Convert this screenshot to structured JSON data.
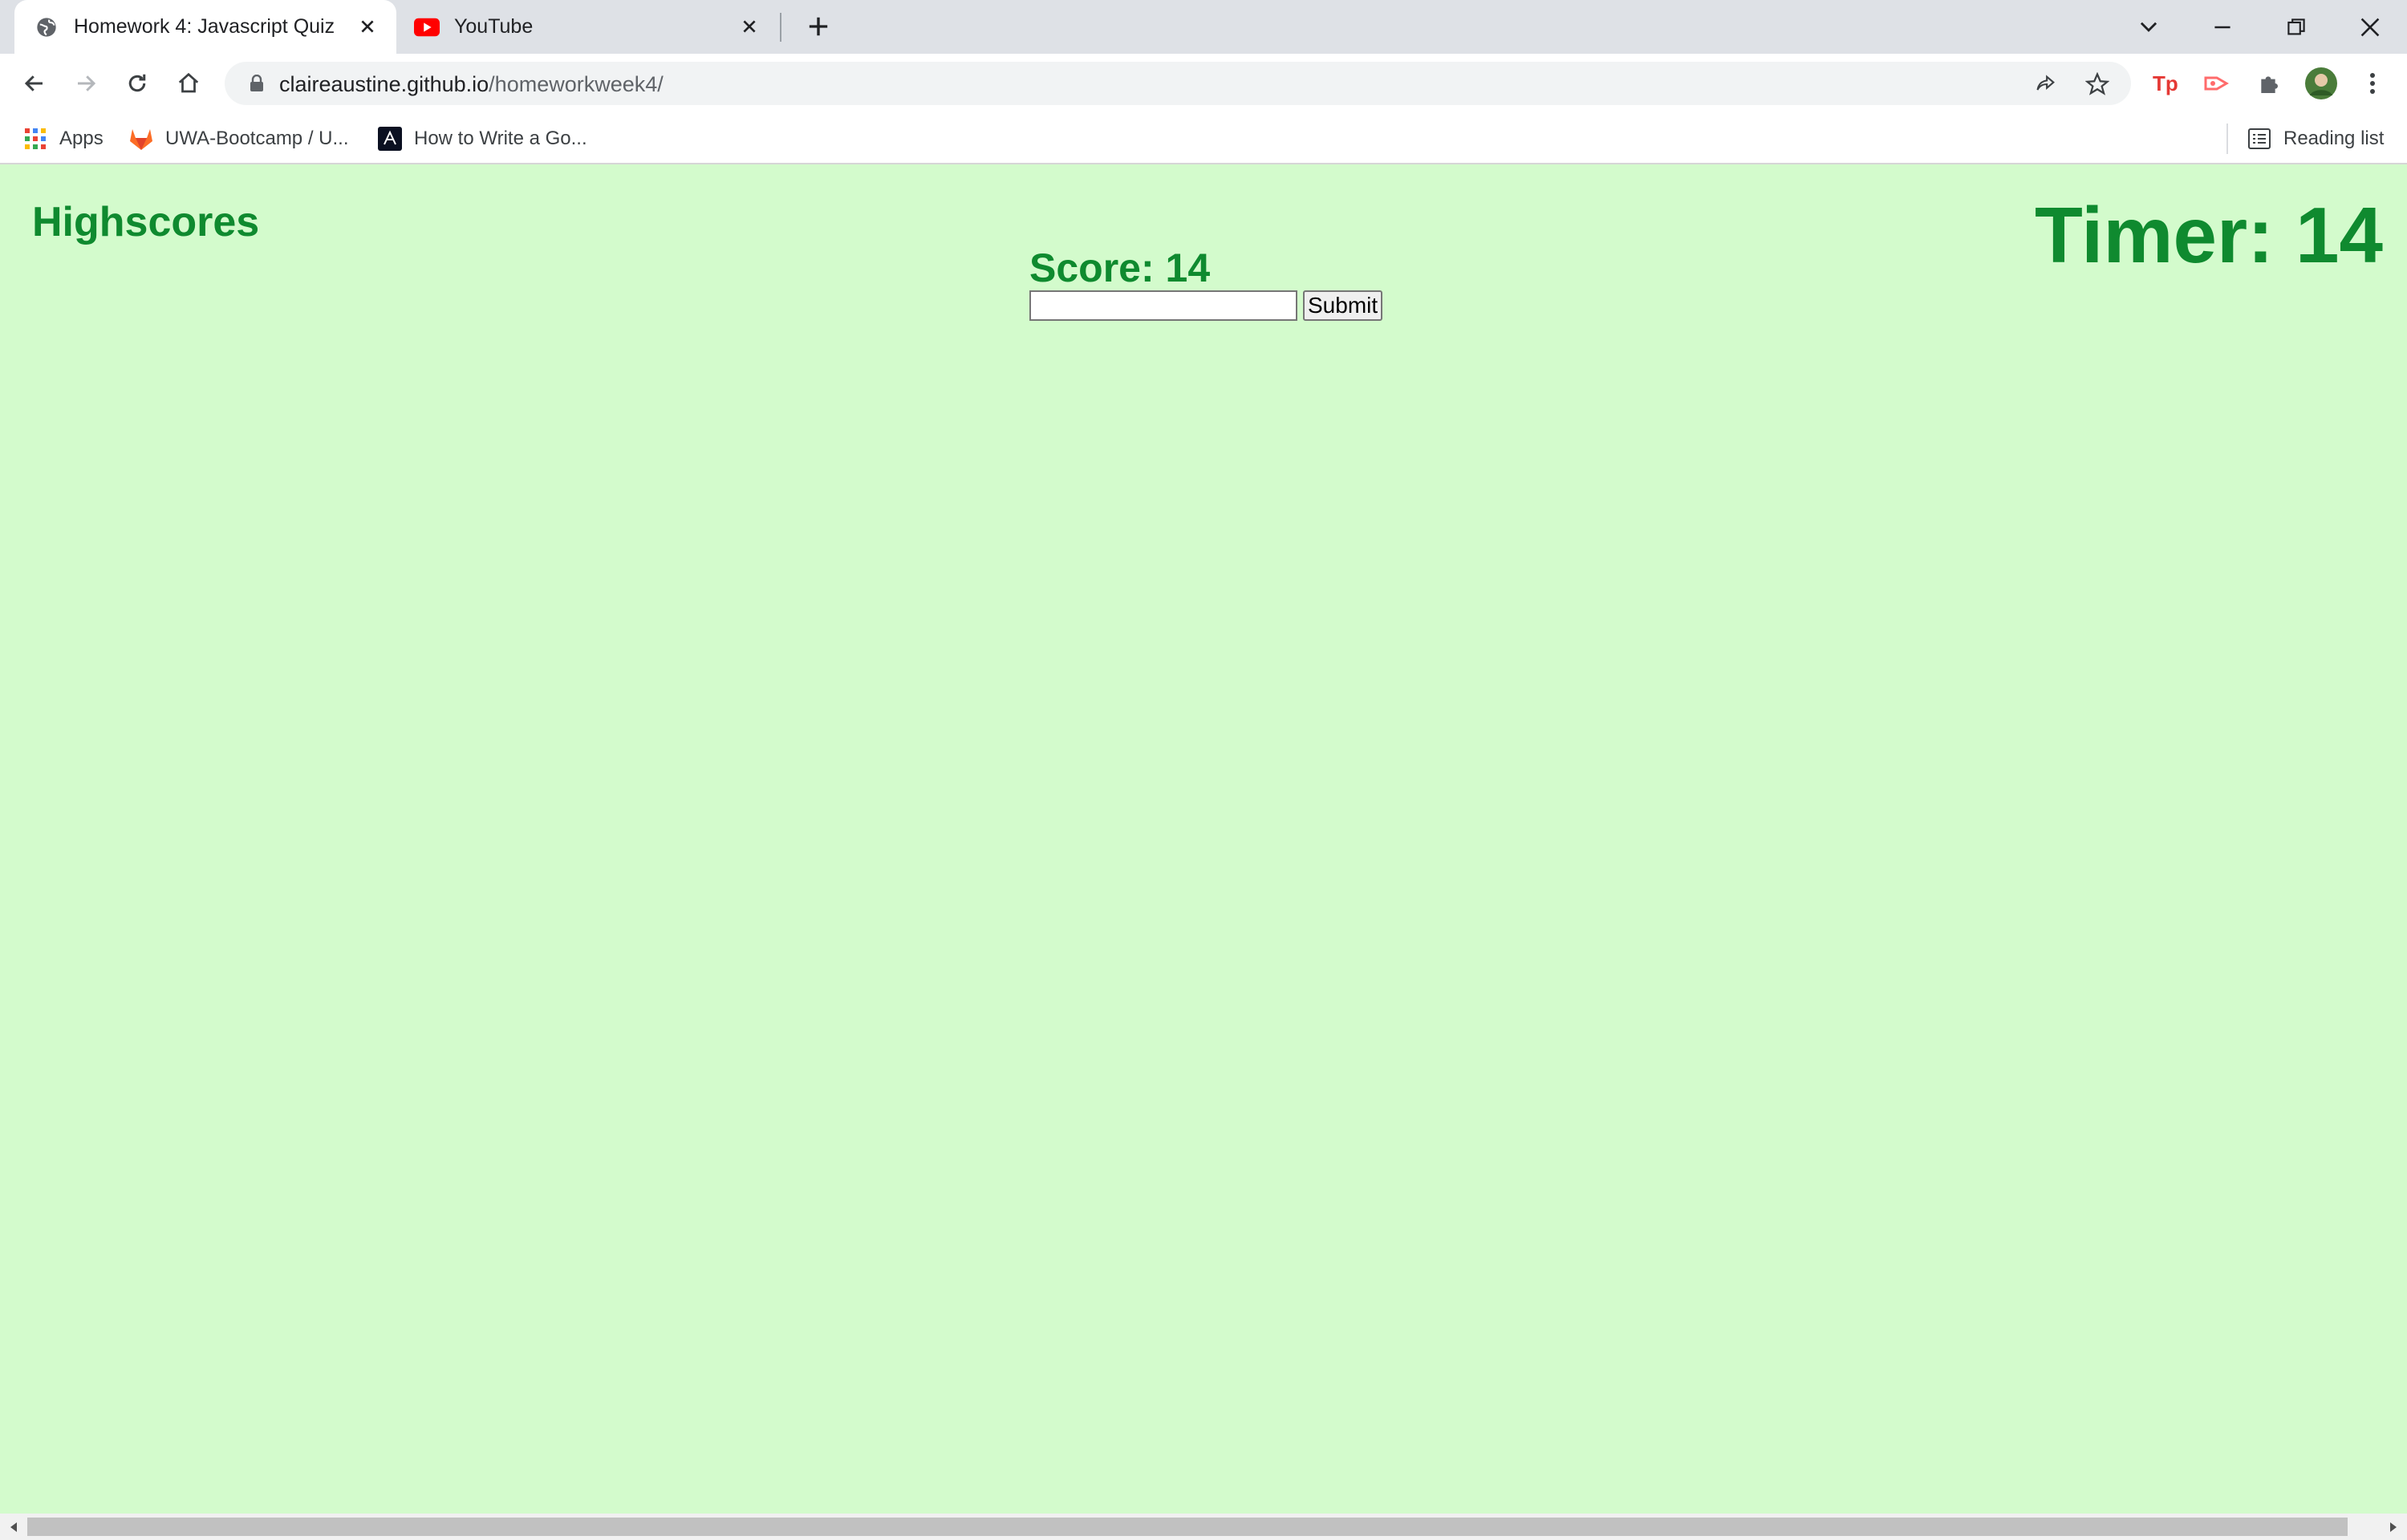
{
  "browser": {
    "tabs": [
      {
        "title": "Homework 4: Javascript Quiz",
        "active": true,
        "icon": "globe-icon"
      },
      {
        "title": "YouTube",
        "active": false,
        "icon": "youtube-icon"
      }
    ],
    "address": {
      "host": "claireaustine.github.io",
      "path": "/homeworkweek4/"
    },
    "bookmarks": [
      {
        "label": "Apps",
        "icon": "apps-grid-icon"
      },
      {
        "label": "UWA-Bootcamp / U...",
        "icon": "gitlab-icon"
      },
      {
        "label": "How to Write a Go...",
        "icon": "site-icon"
      }
    ],
    "reading_list_label": "Reading list"
  },
  "page": {
    "highscores_link": "Highscores",
    "timer_label": "Timer: 14",
    "score_label": "Score: 14",
    "initials_value": "",
    "submit_label": "Submit"
  },
  "colors": {
    "page_background": "#d3fbcc",
    "heading_green": "#0f8a2f"
  }
}
